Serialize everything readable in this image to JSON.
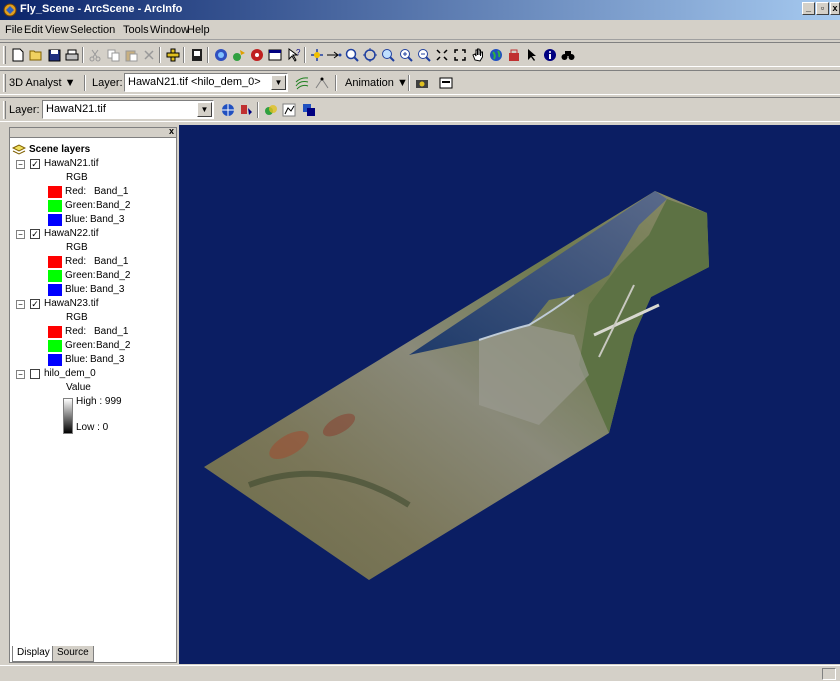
{
  "window": {
    "title": "Fly_Scene - ArcScene - ArcInfo",
    "minimize_label": "_",
    "restore_label": "▫",
    "close_label": "x"
  },
  "menu": {
    "items": [
      "File",
      "Edit",
      "View",
      "Selection",
      "Tools",
      "Window",
      "Help"
    ]
  },
  "analyst_toolbar": {
    "menu_label": "3D Analyst ▼",
    "layer_label": "Layer:",
    "layer_value": "HawaN21.tif <hilo_dem_0>",
    "animation_label": "Animation ▼"
  },
  "layer_toolbar": {
    "layer_label": "Layer:",
    "layer_value": "HawaN21.tif"
  },
  "toc": {
    "root_label": "Scene layers",
    "close_label": "x",
    "layers": [
      {
        "name": "HawaN21.tif",
        "checked": true,
        "renderer": "RGB",
        "bands": [
          {
            "label": "Red:",
            "band": "Band_1",
            "color": "#ff0000"
          },
          {
            "label": "Green:",
            "band": "Band_2",
            "color": "#00ff00"
          },
          {
            "label": "Blue:",
            "band": "Band_3",
            "color": "#0000ff"
          }
        ]
      },
      {
        "name": "HawaN22.tif",
        "checked": true,
        "renderer": "RGB",
        "bands": [
          {
            "label": "Red:",
            "band": "Band_1",
            "color": "#ff0000"
          },
          {
            "label": "Green:",
            "band": "Band_2",
            "color": "#00ff00"
          },
          {
            "label": "Blue:",
            "band": "Band_3",
            "color": "#0000ff"
          }
        ]
      },
      {
        "name": "HawaN23.tif",
        "checked": true,
        "renderer": "RGB",
        "bands": [
          {
            "label": "Red:",
            "band": "Band_1",
            "color": "#ff0000"
          },
          {
            "label": "Green:",
            "band": "Band_2",
            "color": "#00ff00"
          },
          {
            "label": "Blue:",
            "band": "Band_3",
            "color": "#0000ff"
          }
        ]
      },
      {
        "name": "hilo_dem_0",
        "checked": false,
        "renderer": "Value",
        "high_label": "High : 999",
        "low_label": "Low : 0"
      }
    ],
    "tabs": [
      "Display",
      "Source"
    ],
    "active_tab": "Display"
  },
  "colors": {
    "scene_background": "#0b1e63",
    "title_bar_start": "#0a246a",
    "title_bar_end": "#a6caf0",
    "dialog_face": "#d4d0c8"
  },
  "icons": {
    "standard_toolbar": [
      "new-icon",
      "open-icon",
      "save-icon",
      "print-icon",
      "cut-icon",
      "copy-icon",
      "paste-icon",
      "delete-icon",
      "add-data-icon",
      "full-extent-icon",
      "navigate-icon",
      "fly-icon",
      "zoom-in-out-icon",
      "select-extent-icon",
      "identify-icon",
      "center-target-icon",
      "set-observer-icon",
      "zoom-in-icon",
      "zoom-out-icon",
      "zoom-to-target-icon",
      "zoom-in-fixed-icon",
      "zoom-out-fixed-icon",
      "full-extent-view-icon",
      "full-extent-scene-icon",
      "pan-icon",
      "globe-icon",
      "arc-toolbox-icon",
      "select-pointer-icon",
      "info-icon",
      "find-binoculars-icon"
    ]
  }
}
